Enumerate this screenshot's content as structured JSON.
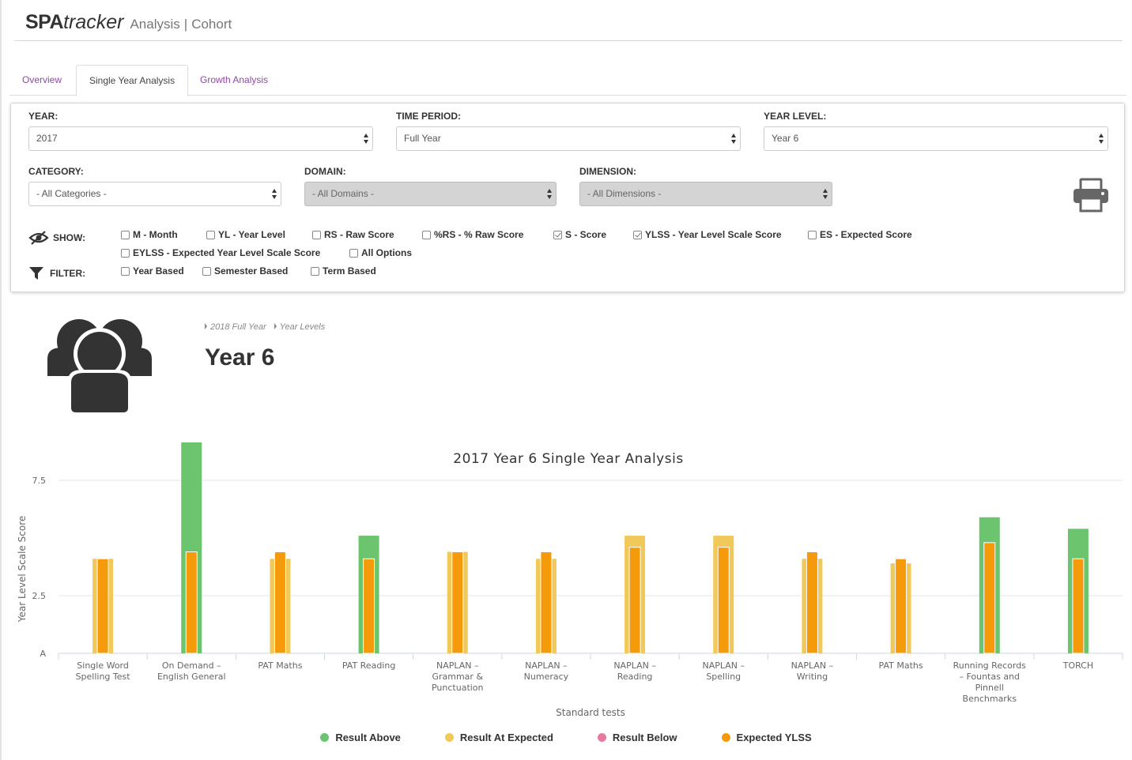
{
  "header": {
    "brand_bold": "SPA",
    "brand_italic": "tracker",
    "section": "Analysis",
    "subsection": "Cohort"
  },
  "tabs": [
    {
      "label": "Overview",
      "active": false
    },
    {
      "label": "Single Year Analysis",
      "active": true
    },
    {
      "label": "Growth Analysis",
      "active": false
    }
  ],
  "filters": {
    "year": {
      "label": "YEAR:",
      "value": "2017"
    },
    "time_period": {
      "label": "TIME PERIOD:",
      "value": "Full Year"
    },
    "year_level": {
      "label": "YEAR LEVEL:",
      "value": "Year 6"
    },
    "category": {
      "label": "CATEGORY:",
      "value": "- All Categories -"
    },
    "domain": {
      "label": "DOMAIN:",
      "value": "- All Domains -",
      "disabled": true
    },
    "dimension": {
      "label": "DIMENSION:",
      "value": "- All Dimensions -",
      "disabled": true
    },
    "print_icon": "printer-icon"
  },
  "show": {
    "label": "SHOW:",
    "icon": "eye-slash-icon",
    "options": [
      {
        "label": "M - Month",
        "checked": false
      },
      {
        "label": "YL - Year Level",
        "checked": false
      },
      {
        "label": "RS - Raw Score",
        "checked": false
      },
      {
        "label": "%RS - % Raw Score",
        "checked": false
      },
      {
        "label": "S - Score",
        "checked": true
      },
      {
        "label": "YLSS - Year Level Scale Score",
        "checked": true
      },
      {
        "label": "ES - Expected Score",
        "checked": false
      },
      {
        "label": "EYLSS - Expected Year Level Scale Score",
        "checked": false
      },
      {
        "label": "All Options",
        "checked": false
      }
    ]
  },
  "filter": {
    "label": "FILTER:",
    "icon": "funnel-icon",
    "options": [
      {
        "label": "Year Based",
        "checked": false
      },
      {
        "label": "Semester Based",
        "checked": false
      },
      {
        "label": "Term Based",
        "checked": false
      }
    ]
  },
  "cohort": {
    "icon": "group-users-icon",
    "breadcrumbs": [
      "2018 Full Year",
      "Year Levels"
    ],
    "title": "Year 6"
  },
  "chart_data": {
    "type": "bar",
    "title": "2017 Year 6 Single Year Analysis",
    "xlabel": "Standard tests",
    "ylabel": "Year Level Scale Score",
    "y_ticks": [
      "A",
      "2.5",
      "7.5"
    ],
    "ylim": [
      0,
      10
    ],
    "categories": [
      "Single Word Spelling Test",
      "On Demand - English General",
      "PAT Maths",
      "PAT Reading",
      "NAPLAN - Grammar & Punctuation",
      "NAPLAN - Numeracy",
      "NAPLAN - Reading",
      "NAPLAN - Spelling",
      "NAPLAN - Writing",
      "PAT Maths",
      "Running Records - Fountas and Pinnell Benchmarks",
      "TORCH"
    ],
    "series": [
      {
        "name": "Result",
        "values": [
          4.1,
          9.2,
          4.1,
          5.1,
          4.4,
          4.1,
          5.1,
          5.1,
          4.1,
          3.9,
          5.9,
          5.4
        ],
        "statuses": [
          "expected",
          "above",
          "expected",
          "above",
          "expected",
          "expected",
          "expected",
          "expected",
          "expected",
          "expected",
          "above",
          "above"
        ]
      },
      {
        "name": "Expected YLSS",
        "values": [
          4.1,
          4.4,
          4.4,
          4.1,
          4.4,
          4.4,
          4.6,
          4.6,
          4.4,
          4.1,
          4.8,
          4.1
        ]
      }
    ],
    "legend": [
      {
        "label": "Result Above",
        "color": "#6cc46f"
      },
      {
        "label": "Result At Expected",
        "color": "#f1c85a"
      },
      {
        "label": "Result Below",
        "color": "#e87aa0"
      },
      {
        "label": "Expected YLSS",
        "color": "#f59b0b"
      }
    ],
    "legend_position": "bottom-center",
    "grid": true
  }
}
